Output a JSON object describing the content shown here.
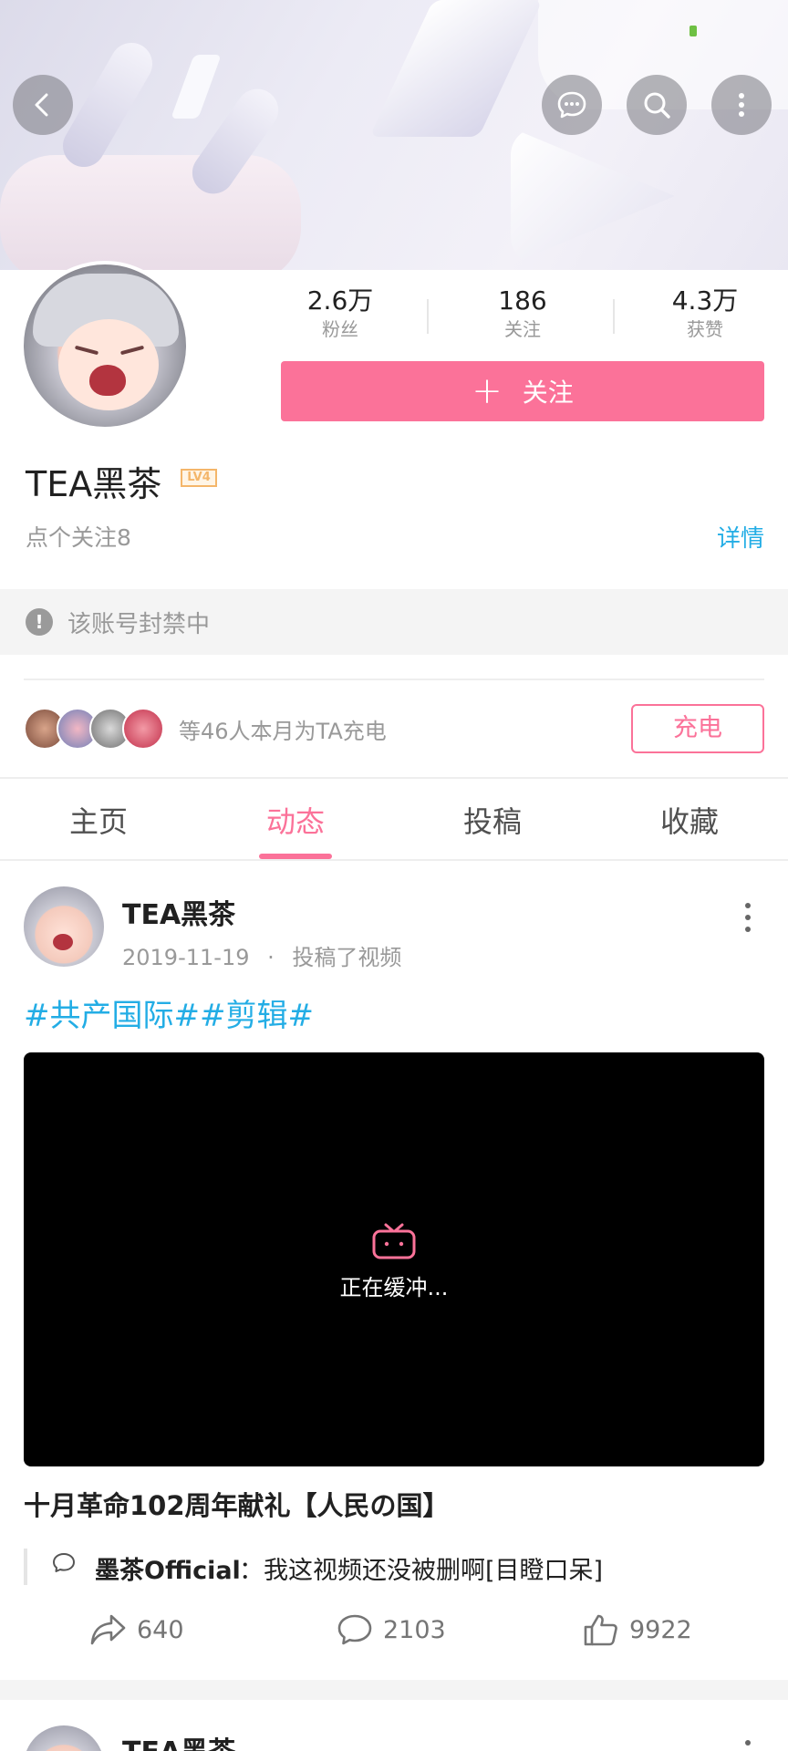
{
  "header": {
    "back_icon": "chevron-left-icon",
    "message_icon": "chat-bubble-icon",
    "search_icon": "search-icon",
    "more_icon": "more-vertical-icon"
  },
  "profile": {
    "stats": [
      {
        "value": "2.6万",
        "label": "粉丝"
      },
      {
        "value": "186",
        "label": "关注"
      },
      {
        "value": "4.3万",
        "label": "获赞"
      }
    ],
    "follow_plus": "+",
    "follow_label": "关注",
    "username": "TEA黑茶",
    "level": "LV4",
    "signature": "点个关注8",
    "detail_link": "详情"
  },
  "notice": {
    "icon_glyph": "!",
    "text": "该账号封禁中"
  },
  "charge": {
    "text": "等46人本月为TA充电",
    "button": "充电"
  },
  "tabs": {
    "items": [
      {
        "label": "主页"
      },
      {
        "label": "动态"
      },
      {
        "label": "投稿"
      },
      {
        "label": "收藏"
      }
    ],
    "active_index": 1
  },
  "post": {
    "author": "TEA黑茶",
    "date": "2019-11-19",
    "separator": "·",
    "action": "投稿了视频",
    "tags": "#共产国际##剪辑#",
    "video_status": "正在缓冲...",
    "video_title": "十月革命102周年献礼【人民の国】",
    "comment_author": "墨茶Official",
    "comment_text": "：我这视频还没被删啊[目瞪口呆]",
    "share_count": "640",
    "comment_count": "2103",
    "like_count": "9922"
  },
  "post2": {
    "author": "TEA黑茶"
  },
  "colors": {
    "accent": "#fb7299",
    "link": "#23ade5",
    "muted": "#999999"
  }
}
